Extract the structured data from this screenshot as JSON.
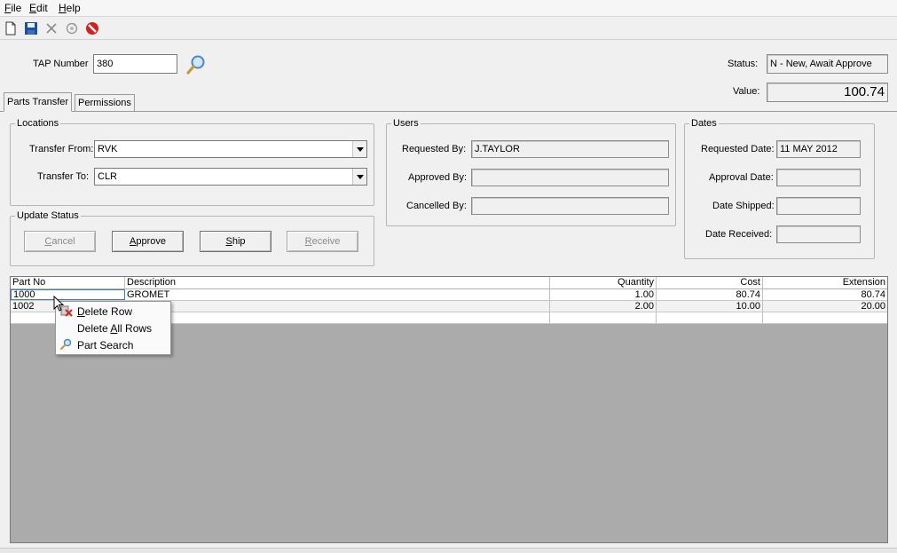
{
  "menu": {
    "file_first": "F",
    "file_rest": "ile",
    "edit_first": "E",
    "edit_rest": "dit",
    "help_first": "H",
    "help_rest": "elp"
  },
  "toolbar": {
    "icons": [
      "new-document-icon",
      "save-disk-icon",
      "delete-x-icon",
      "refresh-icon",
      "cancel-stop-icon"
    ]
  },
  "header": {
    "tap_label": "TAP Number",
    "tap_value": "380",
    "status_label": "Status:",
    "status_value": "N - New, Await Approve",
    "value_label": "Value:",
    "value_value": "100.74"
  },
  "tabs": [
    {
      "label": "Parts Transfer",
      "active": true
    },
    {
      "label": "Permissions",
      "active": false
    }
  ],
  "locations": {
    "title": "Locations",
    "from_label": "Transfer From:",
    "from_value": "RVK",
    "to_label": "Transfer To:",
    "to_value": "CLR"
  },
  "update_status": {
    "title": "Update Status",
    "cancel_pre": "",
    "cancel_key": "C",
    "cancel_post": "ancel",
    "approve_pre": "",
    "approve_key": "A",
    "approve_post": "pprove",
    "ship_pre": "",
    "ship_key": "S",
    "ship_post": "hip",
    "receive_pre": "",
    "receive_key": "R",
    "receive_post": "eceive"
  },
  "users": {
    "title": "Users",
    "requested_label": "Requested By:",
    "requested_value": "J.TAYLOR",
    "approved_label": "Approved By:",
    "approved_value": "",
    "cancelled_label": "Cancelled By:",
    "cancelled_value": ""
  },
  "dates": {
    "title": "Dates",
    "requested_label": "Requested Date:",
    "requested_value": "11 MAY 2012",
    "approval_label": "Approval Date:",
    "approval_value": "",
    "shipped_label": "Date Shipped:",
    "shipped_value": "",
    "received_label": "Date Received:",
    "received_value": ""
  },
  "grid": {
    "columns": [
      "Part No",
      "Description",
      "Quantity",
      "Cost",
      "Extension"
    ],
    "rows": [
      {
        "part_no": "1000",
        "description": "GROMET",
        "quantity": "1.00",
        "cost": "80.74",
        "extension": "80.74"
      },
      {
        "part_no": "1002",
        "description": "",
        "quantity": "2.00",
        "cost": "10.00",
        "extension": "20.00"
      },
      {
        "part_no": "",
        "description": "",
        "quantity": "",
        "cost": "",
        "extension": ""
      }
    ]
  },
  "context_menu": {
    "delete_row_key": "D",
    "delete_row_post": "elete Row",
    "delete_all_pre": "Delete ",
    "delete_all_key": "A",
    "delete_all_post": "ll Rows",
    "part_search": "Part Search"
  },
  "colors": {
    "window_bg": "#f0f0f0",
    "grid_empty_bg": "#ababab",
    "stop_icon": "#d42020",
    "save_icon": "#1f4e9c"
  }
}
